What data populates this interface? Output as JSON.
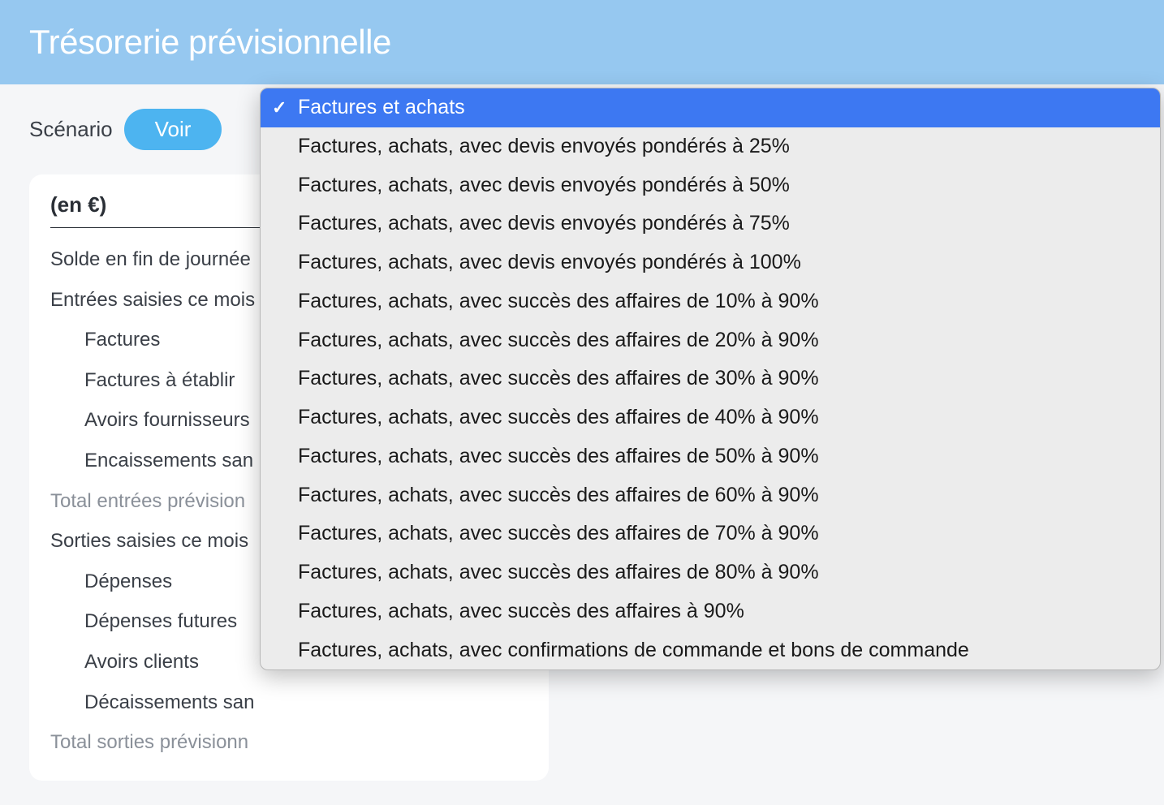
{
  "header": {
    "title": "Trésorerie prévisionnelle"
  },
  "scenario": {
    "label": "Scénario",
    "button": "Voir"
  },
  "table": {
    "currency_header": "(en €)",
    "rows": [
      {
        "label": "Solde en fin de journée",
        "indent": false,
        "muted": false
      },
      {
        "label": "Entrées saisies ce mois",
        "indent": false,
        "muted": false
      },
      {
        "label": "Factures",
        "indent": true,
        "muted": false
      },
      {
        "label": "Factures à établir",
        "indent": true,
        "muted": false
      },
      {
        "label": "Avoirs fournisseurs",
        "indent": true,
        "muted": false
      },
      {
        "label": "Encaissements san",
        "indent": true,
        "muted": false
      },
      {
        "label": "Total entrées prévision",
        "indent": false,
        "muted": true
      },
      {
        "label": "Sorties saisies ce mois",
        "indent": false,
        "muted": false
      },
      {
        "label": "Dépenses",
        "indent": true,
        "muted": false
      },
      {
        "label": "Dépenses futures",
        "indent": true,
        "muted": false
      },
      {
        "label": "Avoirs clients",
        "indent": true,
        "muted": false
      },
      {
        "label": "Décaissements san",
        "indent": true,
        "muted": false
      },
      {
        "label": "Total sorties prévisionn",
        "indent": false,
        "muted": true
      }
    ]
  },
  "dropdown": {
    "selected_index": 0,
    "options": [
      "Factures et achats",
      "Factures, achats, avec devis envoyés pondérés à 25%",
      "Factures, achats, avec devis envoyés pondérés à 50%",
      "Factures, achats, avec devis envoyés pondérés à 75%",
      "Factures, achats, avec devis envoyés pondérés à 100%",
      "Factures, achats, avec succès des affaires de 10% à 90%",
      "Factures, achats, avec succès des affaires de 20% à 90%",
      "Factures, achats, avec succès des affaires de 30% à 90%",
      "Factures, achats, avec succès des affaires de 40% à 90%",
      "Factures, achats, avec succès des affaires de 50% à 90%",
      "Factures, achats, avec succès des affaires de 60% à 90%",
      "Factures, achats, avec succès des affaires de 70% à 90%",
      "Factures, achats, avec succès des affaires de 80% à 90%",
      "Factures, achats, avec succès des affaires à 90%",
      "Factures, achats, avec confirmations de commande et bons de commande"
    ]
  }
}
